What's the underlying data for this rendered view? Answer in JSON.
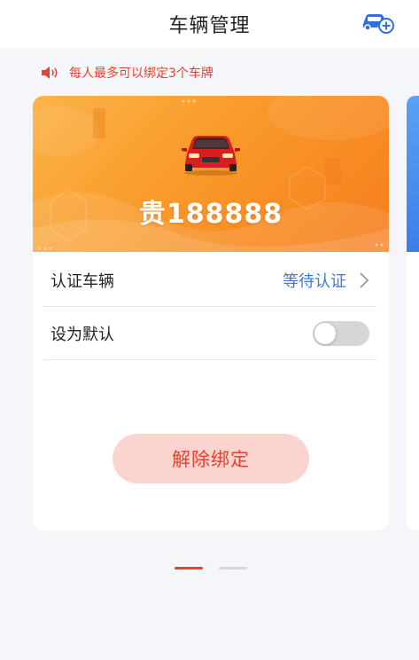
{
  "header": {
    "title": "车辆管理",
    "add_icon": "car-add-icon"
  },
  "notice": {
    "icon": "speaker-icon",
    "text": "每人最多可以绑定3个车牌"
  },
  "cards": [
    {
      "plate": "贵188888",
      "car_icon": "red-car-icon",
      "verify_label": "认证车辆",
      "verify_status": "等待认证",
      "default_label": "设为默认",
      "default_on": false,
      "unbind_label": "解除绑定"
    }
  ],
  "pager": {
    "pages": 2,
    "active_index": 0
  },
  "colors": {
    "accent": "#e2432f",
    "status_blue": "#3b7bd8",
    "banner_orange": "#f99a2a",
    "unbind_bg": "#fbd3cf",
    "page_bg": "#f5f6fa"
  }
}
